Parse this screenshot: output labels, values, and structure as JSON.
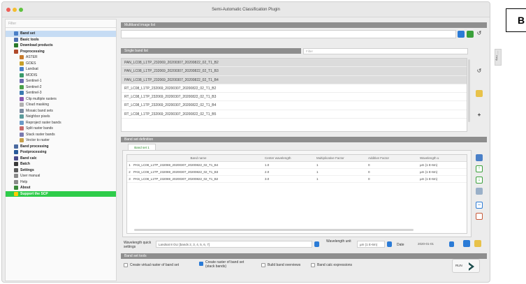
{
  "window": {
    "title": "Semi-Automatic Classification Plugin"
  },
  "badge": "B",
  "sidebar": {
    "filter_placeholder": "Filter",
    "items": [
      {
        "label": "Band set",
        "bold": true,
        "selected": true,
        "indent": 0,
        "color": "#4a80c8"
      },
      {
        "label": "Basic tools",
        "bold": true,
        "indent": 0,
        "color": "#4b6fb0"
      },
      {
        "label": "Download products",
        "bold": true,
        "indent": 0,
        "color": "#2a7a2a"
      },
      {
        "label": "Preprocessing",
        "bold": true,
        "indent": 0,
        "color": "#b04a2a"
      },
      {
        "label": "ASTER",
        "indent": 1,
        "color": "#c87a2a"
      },
      {
        "label": "GOES",
        "indent": 1,
        "color": "#c8a02a"
      },
      {
        "label": "Landsat",
        "indent": 1,
        "color": "#4a80c8"
      },
      {
        "label": "MODIS",
        "indent": 1,
        "color": "#3a9a6a"
      },
      {
        "label": "Sentinel-1",
        "indent": 1,
        "color": "#6a6ab0"
      },
      {
        "label": "Sentinel-2",
        "indent": 1,
        "color": "#4aa04a"
      },
      {
        "label": "Sentinel-3",
        "indent": 1,
        "color": "#3a7ab0"
      },
      {
        "label": "Clip multiple rasters",
        "indent": 1,
        "color": "#8a5ab0"
      },
      {
        "label": "Cloud masking",
        "indent": 1,
        "color": "#b0b0b0"
      },
      {
        "label": "Mosaic band sets",
        "indent": 1,
        "color": "#7a8aa0"
      },
      {
        "label": "Neighbor pixels",
        "indent": 1,
        "color": "#5a9a9a"
      },
      {
        "label": "Reproject raster bands",
        "indent": 1,
        "color": "#6a9ac8"
      },
      {
        "label": "Split raster bands",
        "indent": 1,
        "color": "#c86a6a"
      },
      {
        "label": "Stack raster bands",
        "indent": 1,
        "color": "#7a7ab0"
      },
      {
        "label": "Vector to raster",
        "indent": 1,
        "color": "#c8a04a"
      },
      {
        "label": "Band processing",
        "bold": true,
        "indent": 0,
        "color": "#4a6aa0"
      },
      {
        "label": "Postprocessing",
        "bold": true,
        "indent": 0,
        "color": "#2a5a9a"
      },
      {
        "label": "Band calc",
        "bold": true,
        "indent": 0,
        "color": "#4a4a8a"
      },
      {
        "label": "Batch",
        "bold": true,
        "indent": 0,
        "color": "#3a3a3a"
      },
      {
        "label": "Settings",
        "bold": true,
        "indent": 0,
        "color": "#5a5a5a"
      },
      {
        "label": "User manual",
        "indent": 0,
        "color": "#8a8a8a"
      },
      {
        "label": "Help",
        "indent": 0,
        "color": "#8a8a8a"
      },
      {
        "label": "About",
        "bold": true,
        "indent": 0,
        "color": "#3a8a3a"
      },
      {
        "label": "Support the SCP",
        "bold": true,
        "highlight": true,
        "indent": 0,
        "color": "#ffcc00"
      }
    ]
  },
  "multiband": {
    "header": "Multiband image list"
  },
  "single_band": {
    "header": "Single band list",
    "filter_placeholder": "Filter",
    "rows": [
      {
        "name": "PAN_LC08_L1TP_232069_20200307_20200822_02_T1_B2",
        "selected": true
      },
      {
        "name": "PAN_LC08_L1TP_232069_20200307_20200822_02_T1_B3",
        "selected": true
      },
      {
        "name": "PAN_LC08_L1TP_232069_20200307_20200822_02_T1_B4",
        "selected": true
      },
      {
        "name": "RT_LC08_L1TP_232069_20200307_20200822_02_T1_B2",
        "selected": false
      },
      {
        "name": "RT_LC08_L1TP_232069_20200307_20200822_02_T1_B3",
        "selected": false
      },
      {
        "name": "RT_LC08_L1TP_232069_20200307_20200822_02_T1_B4",
        "selected": false
      },
      {
        "name": "RT_LC08_L1TP_232069_20200307_20200822_02_T1_B5",
        "selected": false
      }
    ]
  },
  "band_set_def": {
    "header": "Band set definition",
    "tab_label": "Band set 1",
    "columns": [
      "Band name",
      "Center wavelength",
      "Multiplicative Factor",
      "Additive Factor",
      "Wavelength u"
    ],
    "rows": [
      {
        "idx": "1",
        "name": "PAN_LC08_L1TP_232069_20200307_20200822_02_T1_B4",
        "wl": "1.0",
        "mult": "1",
        "add": "0",
        "unit": "µm (1 E-6m)"
      },
      {
        "idx": "2",
        "name": "PAN_LC08_L1TP_232069_20200307_20200822_02_T1_B3",
        "wl": "2.0",
        "mult": "1",
        "add": "0",
        "unit": "µm (1 E-6m)"
      },
      {
        "idx": "3",
        "name": "PAN_LC08_L1TP_232069_20200307_20200822_02_T1_B2",
        "wl": "3.0",
        "mult": "1",
        "add": "0",
        "unit": "µm (1 E-6m)"
      }
    ]
  },
  "settings_row": {
    "wavelength_quick_label": "Wavelength quick settings",
    "wavelength_quick_value": "Landsat 8 OLI [bands 2, 3, 4, 5, 6, 7]",
    "wavelength_unit_label": "Wavelength unit",
    "wavelength_unit_value": "µm (1 E-6m)",
    "date_label": "Date",
    "date_value": "2020-01-01"
  },
  "band_set_tools": {
    "header": "Band set tools",
    "options": [
      {
        "label": "Create virtual raster of band set",
        "checked": false
      },
      {
        "label": "Create raster of band set (stack bands)",
        "checked": true
      },
      {
        "label": "Build band overviews",
        "checked": false
      },
      {
        "label": "Band calc expressions",
        "checked": false
      }
    ],
    "run_label": "RUN"
  },
  "right_rail_label": "Help"
}
